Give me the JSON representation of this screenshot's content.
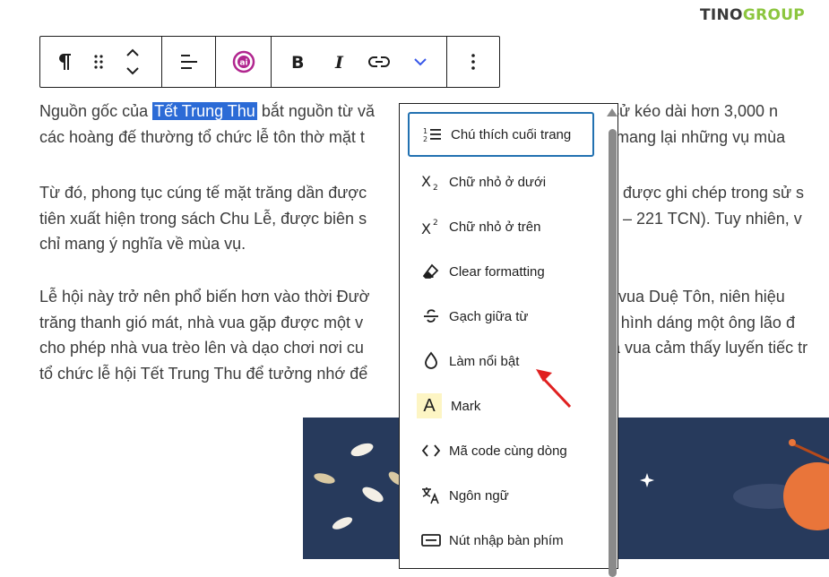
{
  "logo": {
    "part1": "TINO",
    "part2": "GROUP"
  },
  "toolbar": {
    "paragraph_icon": "pilcrow-icon",
    "drag_icon": "drag-handle-icon",
    "move_icon": "move-up-down-icon",
    "align_icon": "align-left-icon",
    "ai_icon": "ai-assistant-icon",
    "bold_icon": "bold-icon",
    "italic_icon": "italic-icon",
    "link_icon": "link-icon",
    "more_format_icon": "chevron-down-icon",
    "options_icon": "more-vertical-icon"
  },
  "content": {
    "p1": {
      "before": "Nguồn gốc của ",
      "highlight": "Tết Trung Thu",
      "after": " bắt nguồn từ vă",
      "line1_tail": "lịch sử kéo dài hơn 3,000 n",
      "line2_head": "các hoàng đế thường tổ chức lễ tôn thờ mặt t",
      "line2_tail": "sẽ mang lại những vụ mùa"
    },
    "p2": {
      "line1_head": "Từ đó, phong tục cúng tế mặt trăng dần được",
      "line1_tail": "à được ghi chép trong sử s",
      "line2_head": "tiên xuất hiện trong sách Chu Lễ, được biên s",
      "line2_tail": "75 – 221 TCN). Tuy nhiên, v",
      "line3": "chỉ mang ý nghĩa về mùa vụ."
    },
    "p3": {
      "line1_head": "Lễ hội này trở nên phổ biến hơn vào thời Đườ",
      "line1_tail": "triều vua Duệ Tôn, niên hiệu",
      "line2_head": "trăng thanh gió mát, nhà vua gặp được một v",
      "line2_tail": "ới hình dáng một ông lão đ",
      "line3_head": "cho phép nhà vua trèo lên và dạo chơi nơi cu",
      "line3_tail": "a vua cảm thấy luyến tiếc tr",
      "line4_head": "tổ chức lễ hội Tết Trung Thu để tưởng nhớ để"
    }
  },
  "menu": {
    "items": [
      {
        "label": "Chú thích cuối trang",
        "icon": "footnote-icon"
      },
      {
        "label": "Chữ nhỏ ở dưới",
        "icon": "subscript-icon"
      },
      {
        "label": "Chữ nhỏ ở trên",
        "icon": "superscript-icon"
      },
      {
        "label": "Clear formatting",
        "icon": "eraser-icon"
      },
      {
        "label": "Gạch giữa từ",
        "icon": "strikethrough-icon"
      },
      {
        "label": "Làm nổi bật",
        "icon": "highlight-drop-icon"
      },
      {
        "label": "Mark",
        "icon": "mark-icon",
        "glyph": "A"
      },
      {
        "label": "Mã code cùng dòng",
        "icon": "code-icon"
      },
      {
        "label": "Ngôn ngữ",
        "icon": "language-icon"
      },
      {
        "label": "Nút nhập bàn phím",
        "icon": "keyboard-icon"
      }
    ]
  },
  "colors": {
    "highlight": "#2c6bd6",
    "focus": "#2271b1",
    "accent_chevron": "#3858e9",
    "arrow": "#e02020",
    "mark_bg": "#fdf5c4",
    "image_bg": "#273a5c"
  }
}
